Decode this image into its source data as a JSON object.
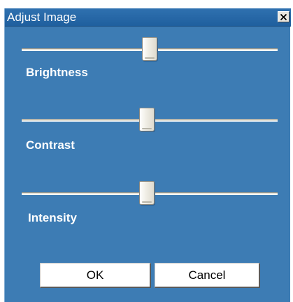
{
  "window": {
    "title": "Adjust Image"
  },
  "sliders": [
    {
      "label": "Brightness",
      "value": 0.5
    },
    {
      "label": "Contrast",
      "value": 0.49
    },
    {
      "label": "Intensity",
      "value": 0.49
    }
  ],
  "buttons": {
    "ok_label": "OK",
    "cancel_label": "Cancel"
  },
  "icons": {
    "close": "close-icon"
  },
  "colors": {
    "dialog_bg": "#3d7cb4",
    "titlebar": "#1f5f9e"
  }
}
